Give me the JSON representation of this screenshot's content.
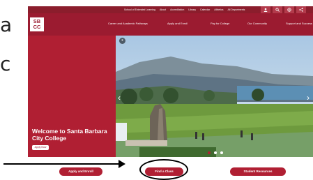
{
  "slide": {
    "left_letters": [
      "a",
      "c"
    ]
  },
  "utility_nav": {
    "links": [
      "School of Extended Learning",
      "About",
      "Accreditation",
      "Library",
      "Calendar",
      "Athletics",
      "All Departments"
    ],
    "icons": [
      "person-icon",
      "search-icon",
      "globe-icon",
      "share-icon"
    ]
  },
  "header": {
    "logo_text": "SB\nCC",
    "nav_items": [
      "Career and Academic Pathways",
      "Apply and Enroll",
      "Pay for College",
      "Our Community",
      "Support and Success"
    ]
  },
  "hero": {
    "title": "Welcome to Santa Barbara City College",
    "apply_button": "Apply Now",
    "pause_glyph": "⏸",
    "prev_glyph": "‹",
    "next_glyph": "›",
    "slide_count": 3,
    "active_slide": 1
  },
  "cta_buttons": [
    "Apply and Enroll",
    "Find a Class",
    "Student Resources"
  ],
  "colors": {
    "brand": "#9b1b30",
    "brand_light": "#b01f33"
  }
}
